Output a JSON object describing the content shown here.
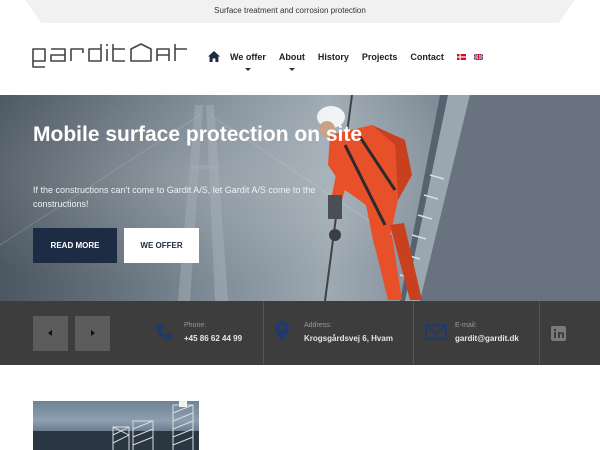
{
  "topbar": {
    "tagline": "Surface treatment and corrosion protection"
  },
  "header": {
    "logo_text": "gardit",
    "nav": [
      {
        "label": "We offer",
        "has_dropdown": true
      },
      {
        "label": "About",
        "has_dropdown": true
      },
      {
        "label": "History",
        "has_dropdown": false
      },
      {
        "label": "Projects",
        "has_dropdown": false
      },
      {
        "label": "Contact",
        "has_dropdown": false
      }
    ],
    "icons": {
      "home": "home-icon",
      "flag_danish": "flag-dk-icon",
      "flag_english": "flag-uk-icon"
    }
  },
  "hero": {
    "title": "Mobile surface protection on site",
    "subtitle": "If the constructions can't come to Gardit A/S, let Gardit A/S come to the constructions!",
    "primary_button": "READ MORE",
    "secondary_button": "WE OFFER"
  },
  "infobar": {
    "phone": {
      "label": "Phone:",
      "value": "+45 86 62 44 99",
      "icon": "phone-icon"
    },
    "address": {
      "label": "Address:",
      "value": "Krogsgårdsvej 6, Hvam",
      "icon": "map-pin-icon"
    },
    "email": {
      "label": "E-mail:",
      "value": "gardit@gardit.dk",
      "icon": "envelope-icon"
    },
    "social_icon": "linkedin-icon",
    "prev_icon": "arrow-left-icon",
    "next_icon": "arrow-right-icon"
  },
  "colors": {
    "brand_navy": "#1d2b45",
    "infobar_bg": "#3d3d3d",
    "accent_orange": "#e8502a"
  }
}
